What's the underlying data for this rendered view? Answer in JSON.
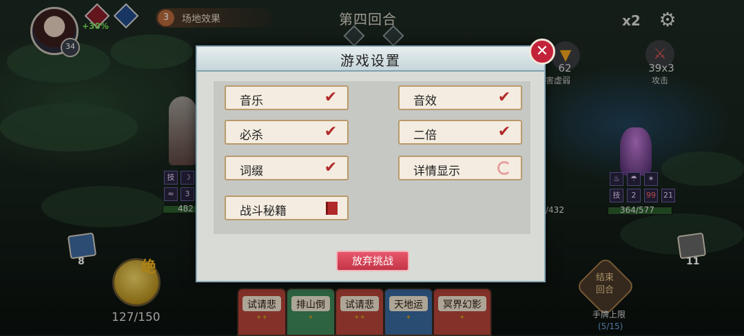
{
  "player": {
    "level": "34",
    "buff_percent": "+30%"
  },
  "field_effect": {
    "count": "3",
    "label": "场地效果"
  },
  "round_label": "第四回合",
  "speed": "x2",
  "intents": [
    {
      "value": "62",
      "label": "害虚弱"
    },
    {
      "value": "39x3",
      "label": "攻击"
    }
  ],
  "hero": {
    "hp": "482",
    "tags": [
      "技",
      "",
      "",
      "3"
    ]
  },
  "enemy": {
    "hp_left": "/432",
    "hp": "364/577",
    "tags": [
      "技",
      "2",
      "99",
      "21"
    ]
  },
  "draw_pile": "8",
  "discard_pile": "11",
  "ultimate_glyph": "绝",
  "energy": "127/150",
  "end_turn": {
    "line1": "结束",
    "line2": "回合"
  },
  "hand_limit": {
    "label": "手牌上限",
    "value": "(5/15)"
  },
  "hand": [
    "试请悲",
    "排山倒",
    "试请悲",
    "天地运",
    "冥界幻影"
  ],
  "settings": {
    "title": "游戏设置",
    "options": [
      {
        "label": "音乐",
        "state": "checked"
      },
      {
        "label": "音效",
        "state": "checked"
      },
      {
        "label": "必杀",
        "state": "checked"
      },
      {
        "label": "二倍",
        "state": "checked"
      },
      {
        "label": "词缀",
        "state": "checked"
      },
      {
        "label": "详情显示",
        "state": "unchecked"
      },
      {
        "label": "战斗秘籍",
        "state": "book"
      }
    ],
    "give_up_label": "放弃挑战",
    "close_glyph": "✕"
  },
  "colors": {
    "accent_red": "#c3233a",
    "check_red": "#b02a2a",
    "ultimate_gold": "#f2b41c"
  }
}
